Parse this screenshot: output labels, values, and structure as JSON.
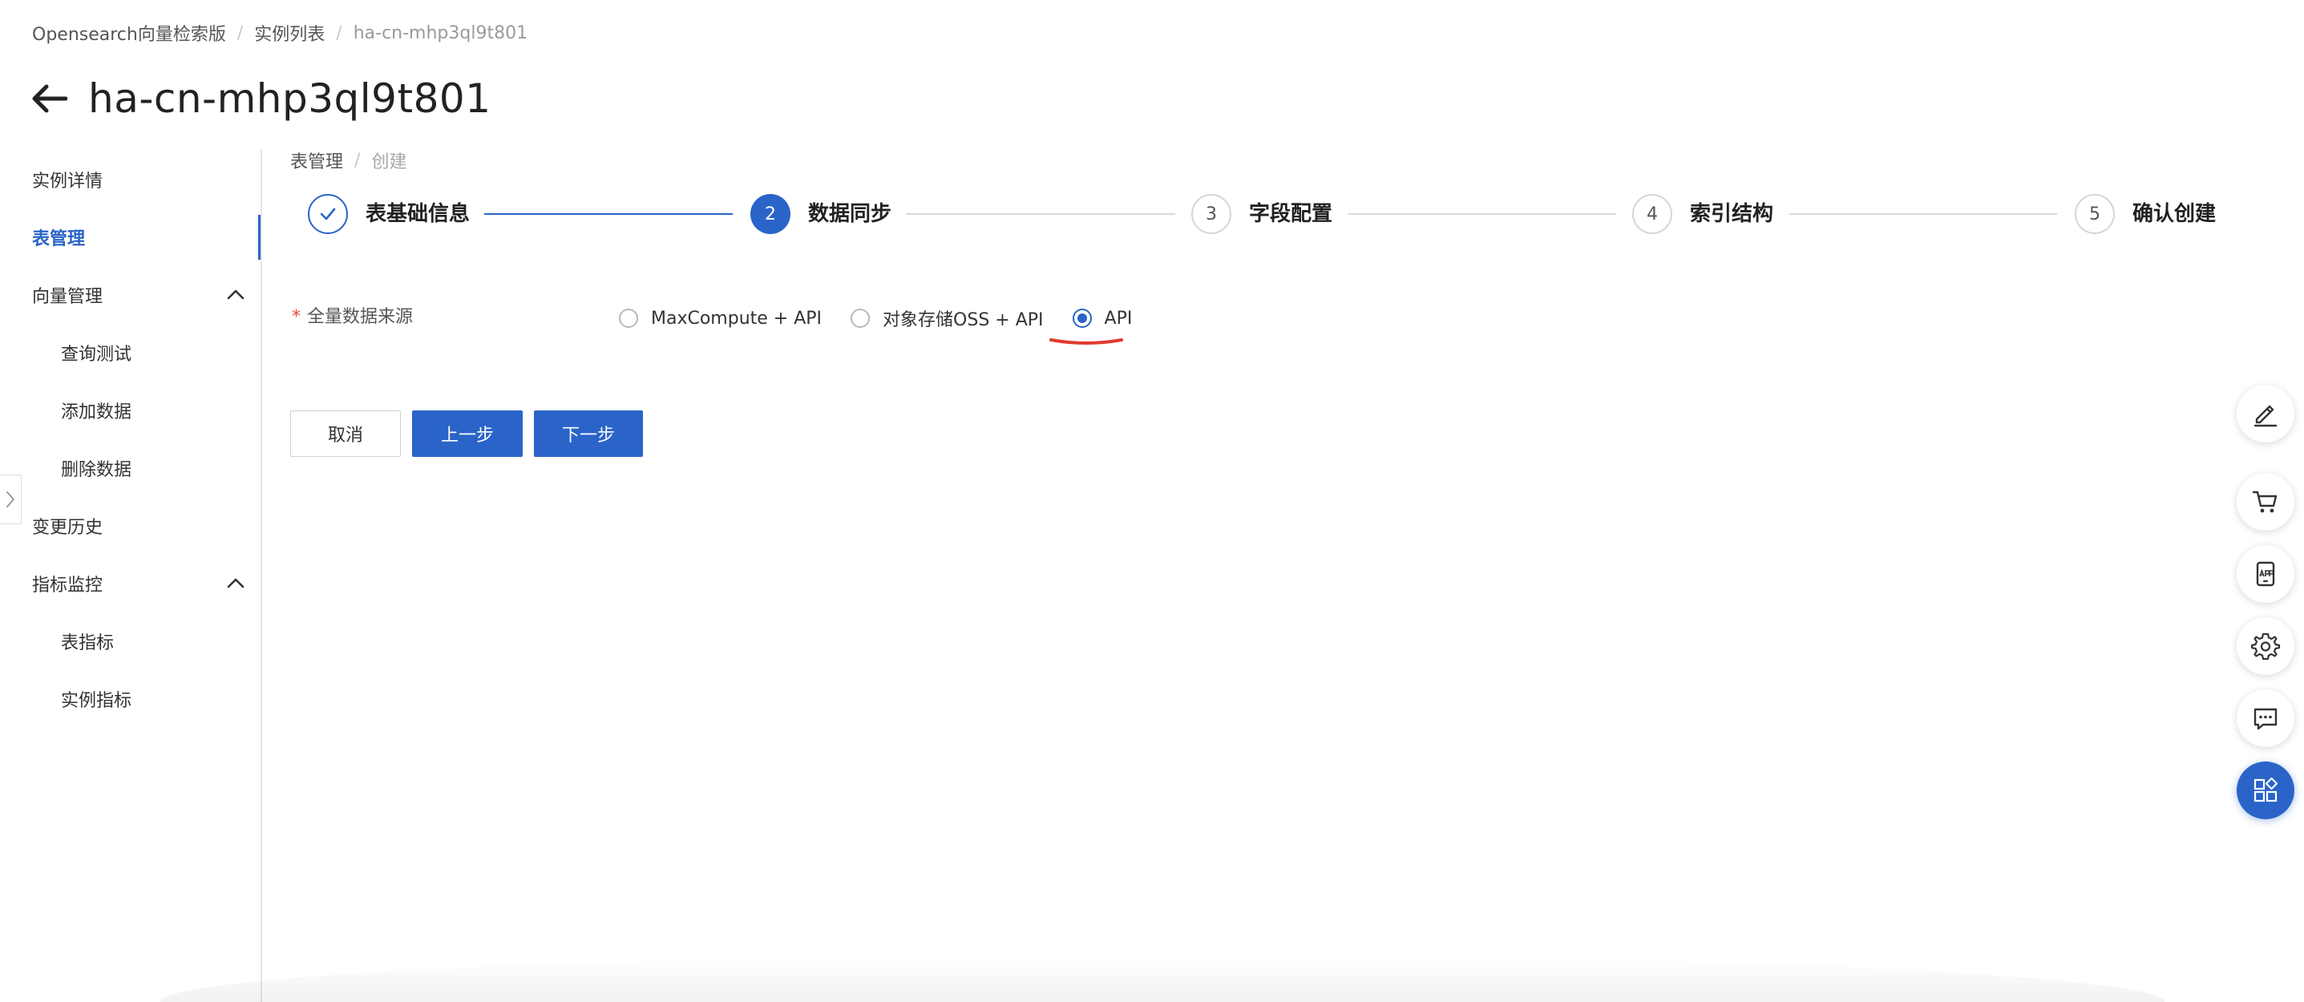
{
  "breadcrumb": {
    "items": [
      "Opensearch向量检索版",
      "实例列表",
      "ha-cn-mhp3ql9t801"
    ]
  },
  "page": {
    "title": "ha-cn-mhp3ql9t801"
  },
  "sidebar": {
    "items": [
      {
        "label": "实例详情"
      },
      {
        "label": "表管理",
        "active": true
      },
      {
        "label": "向量管理"
      },
      {
        "label": "查询测试"
      },
      {
        "label": "添加数据"
      },
      {
        "label": "删除数据"
      },
      {
        "label": "变更历史"
      },
      {
        "label": "指标监控"
      },
      {
        "label": "表指标"
      },
      {
        "label": "实例指标"
      }
    ]
  },
  "content_breadcrumb": {
    "items": [
      "表管理",
      "创建"
    ]
  },
  "steps": [
    {
      "number": "1",
      "label": "表基础信息",
      "status": "done"
    },
    {
      "number": "2",
      "label": "数据同步",
      "status": "current"
    },
    {
      "number": "3",
      "label": "字段配置",
      "status": "todo"
    },
    {
      "number": "4",
      "label": "索引结构",
      "status": "todo"
    },
    {
      "number": "5",
      "label": "确认创建",
      "status": "todo"
    }
  ],
  "form": {
    "required_mark": "*",
    "source_label": "全量数据来源",
    "options": [
      {
        "label": "MaxCompute + API",
        "checked": false
      },
      {
        "label": "对象存储OSS + API",
        "checked": false
      },
      {
        "label": "API",
        "checked": true
      }
    ]
  },
  "buttons": {
    "cancel": "取消",
    "prev": "上一步",
    "next": "下一步"
  },
  "toolbar": {
    "icons": [
      "edit-icon",
      "cart-icon",
      "app-icon",
      "gear-icon",
      "chat-icon",
      "apps-grid-icon"
    ]
  },
  "colors": {
    "primary": "#2a64c8",
    "annotation": "#e03a2f"
  }
}
